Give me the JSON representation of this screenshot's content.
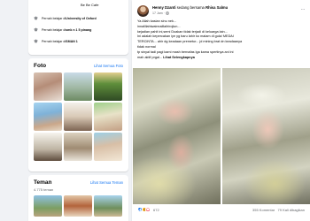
{
  "intro": {
    "cafe": "Be Be Cafe",
    "education": [
      {
        "prefix": "Pernah belajar di ",
        "school": "University of Oxford"
      },
      {
        "prefix": "Pernah belajar di ",
        "school": "smk n 1 5 pinang"
      },
      {
        "prefix": "Pernah belajar di ",
        "school": "SMAN 1"
      }
    ]
  },
  "photos": {
    "title": "Foto",
    "see_all": "Lihat Semua Foto"
  },
  "friends": {
    "title": "Teman",
    "see_all": "Lihat Semua Teman",
    "count": "4.775 teman"
  },
  "post": {
    "author": "Henny Dzanti",
    "with_text": " sedang bersama ",
    "tagged": "Rhisa Salmu",
    "time": "17 Jam",
    "more": "···",
    "text_lines": [
      "Ya Allah kasian sinu nek...",
      "innalillahiwainnaillaihirojiun...",
      "kejadian pahit ini,semi Doakan tidak terjadi di keluarga lain...",
      "Ini adalah kepercakan iye yg baru lahir ko malam di gula/ MEDAI",
      "TERCINTA... ahir dg keadaan premetur... jd mining brat dn keadaanya",
      "tidak normal",
      "tp sinyal tadi pagi kami mash bernafas lga kama spertinya ani ini",
      "mah aktif prgai..."
    ],
    "see_more": "Lihat Selengkapnya",
    "reaction_count": "672",
    "comments": "355 Komentar",
    "shares": "79 Kali dibagikan"
  },
  "colors": {
    "link": "#1877f2",
    "background": "#f0f2f5",
    "card": "#ffffff"
  }
}
